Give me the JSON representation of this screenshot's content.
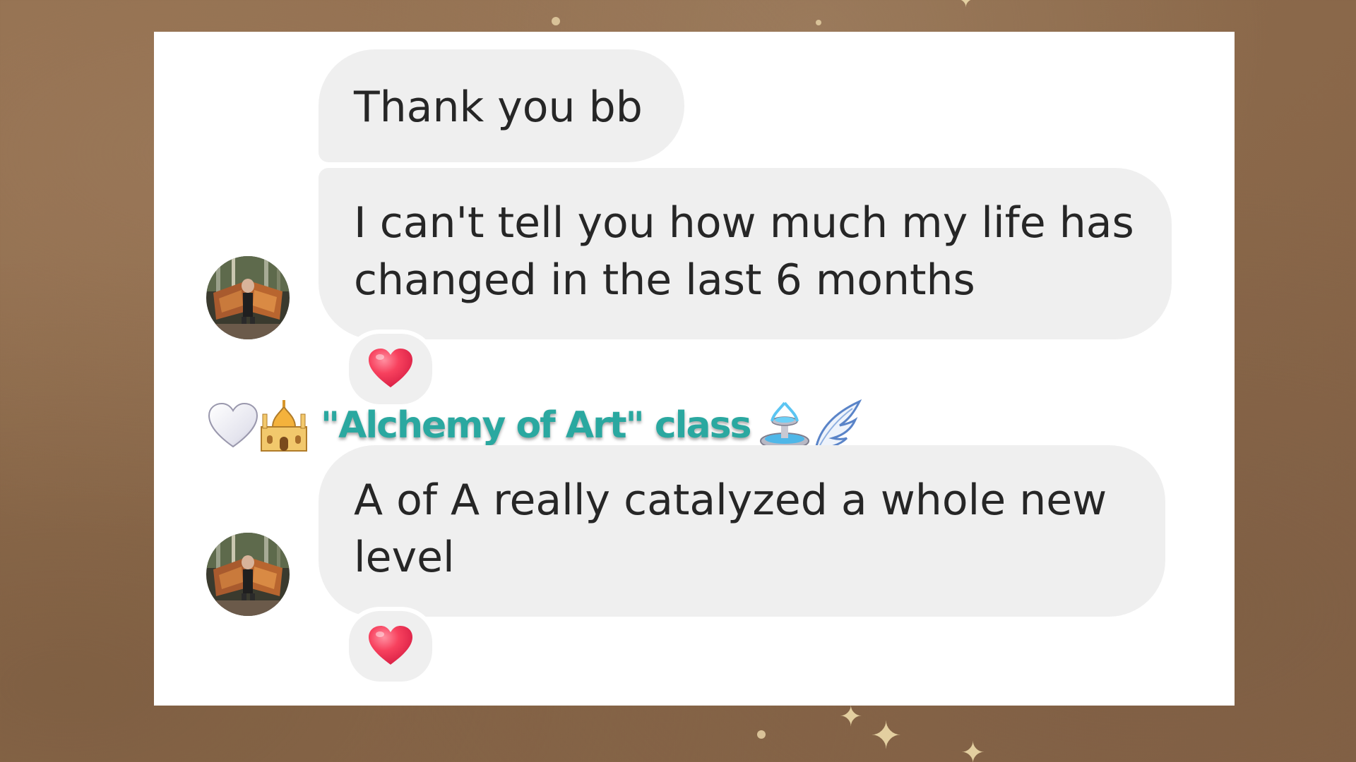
{
  "conversation": {
    "messages": [
      {
        "text": "Thank you bb"
      },
      {
        "text": "I can't tell you how much my life has changed in the last 6 months",
        "line1": "I can't tell you how much my life has",
        "line2": "changed in the last 6 months",
        "reaction": "red-heart"
      },
      {
        "text": "A of A really catalyzed a whole new level",
        "line1": "A of A really catalyzed a whole new",
        "line2": "level",
        "reaction": "red-heart"
      }
    ]
  },
  "banner": {
    "text": "\"Alchemy of Art\" class",
    "icons": [
      "white-heart-icon",
      "mosque-icon",
      "fountain-icon",
      "wing-icon"
    ]
  },
  "colors": {
    "bubble": "#efefef",
    "text": "#262626",
    "banner_text": "#2aa8a0",
    "heart": "#f0304f",
    "background": "#8f6d50"
  }
}
